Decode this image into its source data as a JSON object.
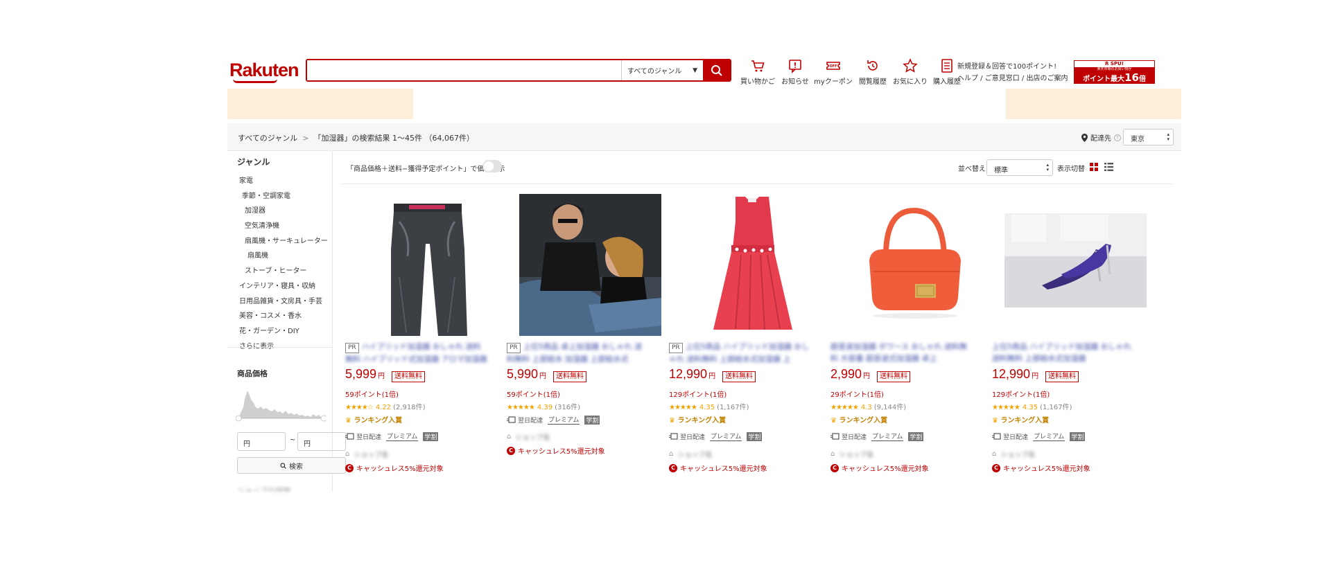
{
  "header": {
    "logo": "Rakuten",
    "search_placeholder": "",
    "genre_label": "すべてのジャンル",
    "nav": [
      {
        "label": "買い物かご",
        "icon": "cart-icon"
      },
      {
        "label": "お知らせ",
        "icon": "notice-icon"
      },
      {
        "label": "myクーポン",
        "icon": "coupon-icon"
      },
      {
        "label": "閲覧履歴",
        "icon": "history-icon"
      },
      {
        "label": "お気に入り",
        "icon": "star-icon"
      },
      {
        "label": "購入履歴",
        "icon": "receipt-icon"
      }
    ],
    "help_line1": "新規登録＆回答で100ポイント!",
    "help_line2": "ヘルプ / ご意見窓口 / 出店のご案内",
    "spu": {
      "top": "R SPU!",
      "mid": "楽天市場のお買い物が",
      "bot_prefix": "ポイント最大",
      "bot_num": "16",
      "bot_suffix": "倍"
    }
  },
  "breadcrumb": {
    "root": "すべてのジャンル",
    "sep": ">",
    "result": "「加湿器」の検索結果 1〜45件 （64,067件）"
  },
  "delivery": {
    "label": "配達先",
    "help": "?",
    "prefecture": "東京"
  },
  "sidebar": {
    "title": "ジャンル",
    "items": [
      "家電",
      "季節・空調家電",
      "加湿器",
      "空気清浄機",
      "扇風機・サーキュレーター",
      "扇風機",
      "ストーブ・ヒーター",
      "インテリア・寝具・収納",
      "日用品雑貨・文房具・手芸",
      "美容・コスメ・香水",
      "花・ガーデン・DIY",
      "さらに表示"
    ],
    "price_title": "商品価格",
    "min_placeholder": "円",
    "max_placeholder": "円",
    "tilde": "~",
    "search_btn": "検索",
    "next_section": "ショップの評価"
  },
  "toolbar": {
    "tax_toggle_label": "「商品価格＋送料−獲得予定ポイント」で価格表示",
    "sort_label": "並べ替え",
    "sort_value": "標準",
    "view_label": "表示切替"
  },
  "products": [
    {
      "pr": "PR",
      "title": "ハイブリッド加湿器 おしゃれ 送料無料 ハイブリッド式加湿器 アロマ加湿器",
      "price": "5,999",
      "yen": "円",
      "ship": "送料無料",
      "points": "59ポイント(1倍)",
      "stars": "★★★★☆",
      "score": "4.22",
      "count": "(2,918件)",
      "rank": "ランキング入賞",
      "next_day": "翌日配達",
      "premium": "プレミアム",
      "gaku": "学割",
      "shop": "ショップ名",
      "cashless": "キャッシュレス5%還元対象"
    },
    {
      "pr": "PR",
      "title": "上位5商品 卓上加湿器 おしゃれ 送料無料 上部給水 加湿器 上部給水式",
      "price": "5,990",
      "yen": "円",
      "ship": "送料無料",
      "points": "59ポイント(1倍)",
      "stars": "★★★★★",
      "score": "4.39",
      "count": "(316件)",
      "rank": "",
      "next_day": "翌日配達",
      "premium": "プレミアム",
      "gaku": "学割",
      "shop": "ショップ名",
      "cashless": "キャッシュレス5%還元対象"
    },
    {
      "pr": "PR",
      "title": "上位5商品 ハイブリッド加湿器 おしゃれ 送料無料 上部給水式加湿器 上",
      "price": "12,990",
      "yen": "円",
      "ship": "送料無料",
      "points": "129ポイント(1倍)",
      "stars": "★★★★★",
      "score": "4.35",
      "count": "(1,167件)",
      "rank": "ランキング入賞",
      "next_day": "翌日配達",
      "premium": "プレミアム",
      "gaku": "学割",
      "shop": "ショップ名",
      "cashless": "キャッシュレス5%還元対象"
    },
    {
      "pr": "",
      "title": "超音波加湿器 ボワース おしゃれ 送料無料 大容量 超音波式加湿器 卓上",
      "price": "2,990",
      "yen": "円",
      "ship": "送料無料",
      "points": "29ポイント(1倍)",
      "stars": "★★★★★",
      "score": "4.3",
      "count": "(9,144件)",
      "rank": "ランキング入賞",
      "next_day": "翌日配達",
      "premium": "プレミアム",
      "gaku": "学割",
      "shop": "ショップ名",
      "cashless": "キャッシュレス5%還元対象"
    },
    {
      "pr": "",
      "title": "上位5商品 ハイブリッド加湿器 おしゃれ 送料無料 上部給水式加湿器",
      "price": "12,990",
      "yen": "円",
      "ship": "送料無料",
      "points": "129ポイント(1倍)",
      "stars": "★★★★★",
      "score": "4.35",
      "count": "(1,167件)",
      "rank": "ランキング入賞",
      "next_day": "翌日配達",
      "premium": "プレミアム",
      "gaku": "学割",
      "shop": "ショップ名",
      "cashless": "キャッシュレス5%還元対象"
    }
  ],
  "colors": {
    "brand": "#bf0000",
    "star": "#f2a200",
    "banner": "#fdf0db"
  }
}
